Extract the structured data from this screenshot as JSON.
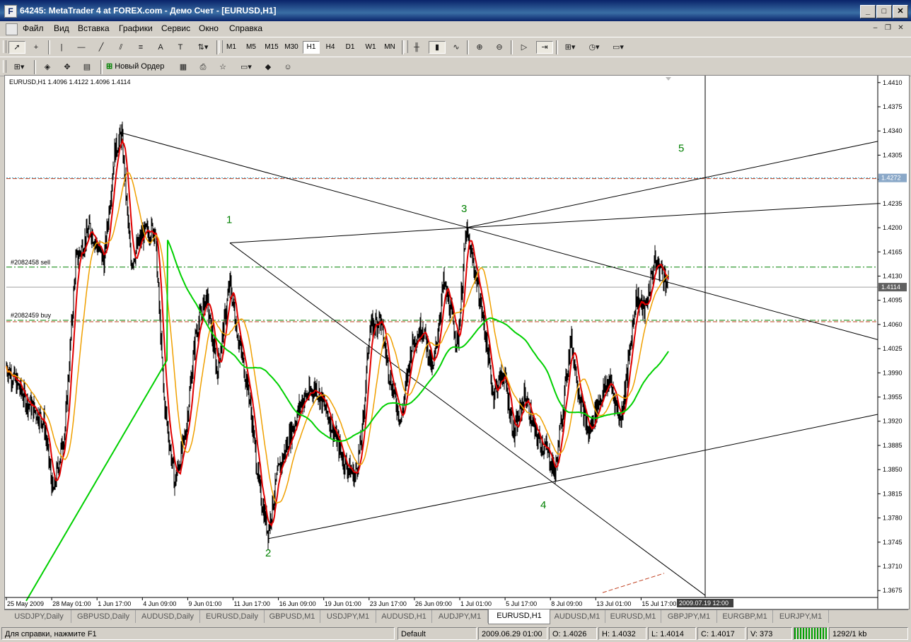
{
  "window": {
    "title": "64245: MetaTrader 4 at FOREX.com - Демо Счет - [EURUSD,H1]",
    "app_icon": "F"
  },
  "menu": [
    "Файл",
    "Вид",
    "Вставка",
    "Графики",
    "Сервис",
    "Окно",
    "Справка"
  ],
  "timeframes": [
    "M1",
    "M5",
    "M15",
    "M30",
    "H1",
    "H4",
    "D1",
    "W1",
    "MN"
  ],
  "active_timeframe": "H1",
  "toolbar2": {
    "new_order_label": "Новый Ордер"
  },
  "chart": {
    "symbol_info": "EURUSD,H1  1.4096 1.4122 1.4096 1.4114",
    "current_price_label": "1.4114",
    "level_price_label": "1.4272",
    "order_labels": [
      "#2082458 sell",
      "#2082459 buy"
    ],
    "wave_labels": [
      "1",
      "2",
      "3",
      "4",
      "5"
    ],
    "crosshair_time_label": "2009.07.19 12:00",
    "colors": {
      "red_ma": "#e00000",
      "orange_ma": "#f0a000",
      "green_ma": "#00d000",
      "order_line": "#008000",
      "level_line": "#c04020",
      "bid_line": "#a0a0a0"
    }
  },
  "chart_data": {
    "type": "candlestick",
    "symbol": "EURUSD",
    "timeframe": "H1",
    "y_ticks": [
      "1.4410",
      "1.4375",
      "1.4340",
      "1.4305",
      "1.4270",
      "1.4235",
      "1.4200",
      "1.4165",
      "1.4130",
      "1.4095",
      "1.4060",
      "1.4025",
      "1.3990",
      "1.3955",
      "1.3920",
      "1.3885",
      "1.3850",
      "1.3815",
      "1.3780",
      "1.3745",
      "1.3710",
      "1.3675"
    ],
    "x_ticks": [
      "25 May 2009",
      "28 May 01:00",
      "1 Jun 17:00",
      "4 Jun 09:00",
      "9 Jun 01:00",
      "11 Jun 17:00",
      "16 Jun 09:00",
      "19 Jun 01:00",
      "23 Jun 17:00",
      "26 Jun 09:00",
      "1 Jul 01:00",
      "5 Jul 17:00",
      "8 Jul 09:00",
      "13 Jul 01:00",
      "15 Jul 17:00"
    ],
    "ylim": [
      1.3665,
      1.442
    ],
    "last_ohlc": {
      "open": 1.4096,
      "high": 1.4122,
      "low": 1.4096,
      "close": 1.4114
    },
    "horizontal_levels": [
      1.4272,
      1.4143,
      1.4114,
      1.4066
    ],
    "wave_points": [
      {
        "label": "1",
        "price": 1.4178
      },
      {
        "label": "2",
        "price": 1.375
      },
      {
        "label": "3",
        "price": 1.42
      },
      {
        "label": "4",
        "price": 1.3833
      },
      {
        "label": "5",
        "price": 1.43
      }
    ]
  },
  "tabs": [
    "USDJPY,Daily",
    "GBPUSD,Daily",
    "AUDUSD,Daily",
    "EURUSD,Daily",
    "GBPUSD,M1",
    "USDJPY,M1",
    "AUDUSD,H1",
    "AUDJPY,M1",
    "EURUSD,H1",
    "AUDUSD,M1",
    "EURUSD,M1",
    "GBPJPY,M1",
    "EURGBP,M1",
    "EURJPY,M1"
  ],
  "active_tab": "EURUSD,H1",
  "status": {
    "help": "Для справки, нажмите F1",
    "profile": "Default",
    "datetime": "2009.06.29 01:00",
    "open": "O: 1.4026",
    "high": "H: 1.4032",
    "low": "L: 1.4014",
    "close": "C: 1.4017",
    "volume": "V: 373",
    "traffic": "1292/1 kb"
  }
}
